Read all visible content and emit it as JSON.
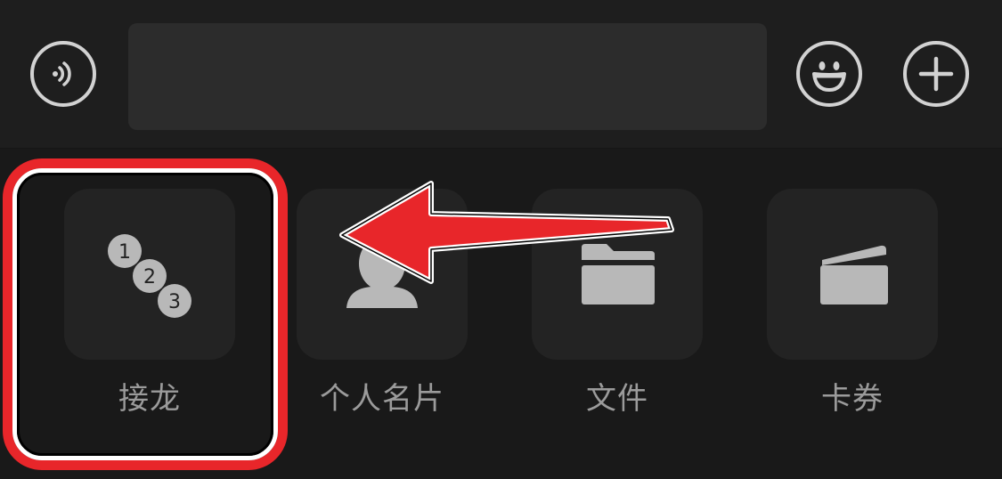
{
  "input_bar": {
    "voice_icon": "voice-wave-icon",
    "emoji_icon": "smiley-face-icon",
    "plus_icon": "plus-icon",
    "message_value": ""
  },
  "tiles": [
    {
      "label": "接龙",
      "icon": "numbered-list-icon",
      "badges": [
        "1",
        "2",
        "3"
      ]
    },
    {
      "label": "个人名片",
      "icon": "person-icon"
    },
    {
      "label": "文件",
      "icon": "folder-icon"
    },
    {
      "label": "卡券",
      "icon": "wallet-icon"
    }
  ],
  "colors": {
    "background": "#191919",
    "input_bar": "#1e1e1e",
    "input_field": "#2c2c2c",
    "tile": "#232323",
    "icon": "#b8b8b8",
    "label": "#9b9b9b",
    "annotation_red": "#e8262a"
  }
}
